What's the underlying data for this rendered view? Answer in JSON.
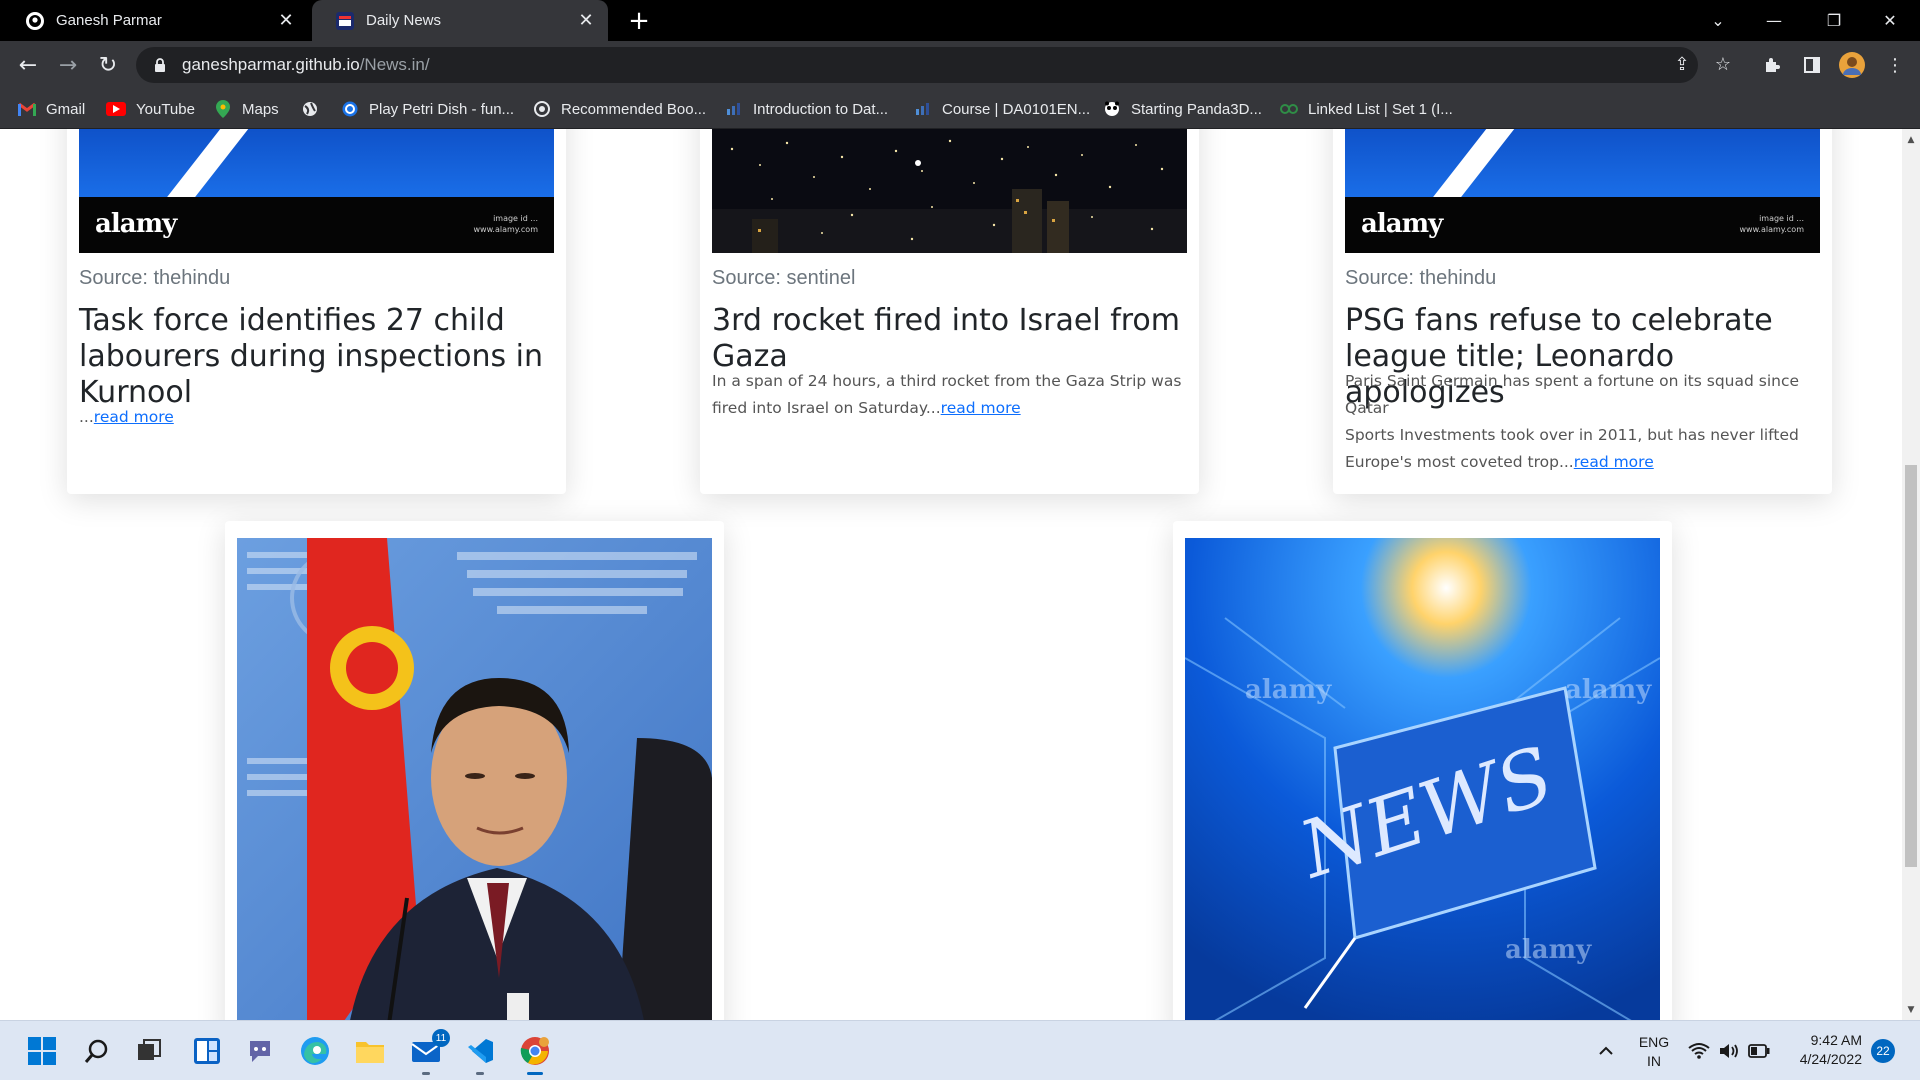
{
  "browser": {
    "tabs": [
      {
        "title": "Ganesh Parmar",
        "active": false
      },
      {
        "title": "Daily News",
        "active": true
      }
    ],
    "url_host": "ganeshparmar.github.io",
    "url_path": "/News.in/",
    "bookmarks": [
      {
        "label": "Gmail",
        "icon": "gmail-icon"
      },
      {
        "label": "YouTube",
        "icon": "youtube-icon"
      },
      {
        "label": "Maps",
        "icon": "maps-icon"
      },
      {
        "label": "",
        "icon": "globe-icon"
      },
      {
        "label": "Play Petri Dish - fun...",
        "icon": "petri-dish-icon"
      },
      {
        "label": "Recommended Boo...",
        "icon": "book-site-icon"
      },
      {
        "label": "Introduction to Dat...",
        "icon": "course-site-icon"
      },
      {
        "label": "Course | DA0101EN...",
        "icon": "course-site-icon"
      },
      {
        "label": "Starting Panda3D...",
        "icon": "panda-icon"
      },
      {
        "label": "Linked List | Set 1 (I...",
        "icon": "gfg-icon"
      }
    ]
  },
  "articles": [
    {
      "source": "Source: thehindu",
      "title_lines": [
        "Task force identifies 27 child",
        "labourers during inspections in",
        "Kurnool"
      ],
      "desc_lines": [
        "..."
      ],
      "read_more": "read more"
    },
    {
      "source": "Source: sentinel",
      "title_lines": [
        "3rd rocket fired into Israel from",
        "Gaza"
      ],
      "desc_lines": [
        "In a span of 24 hours, a third rocket from the Gaza Strip was",
        "fired into Israel on Saturday..."
      ],
      "read_more": "read more"
    },
    {
      "source": "Source: thehindu",
      "title_lines": [
        "PSG fans refuse to celebrate",
        "league title; Leonardo apologizes"
      ],
      "desc_lines": [
        "Paris Saint Germain has spent a fortune on its squad since Qatar",
        "Sports Investments took over in 2011, but has never lifted",
        "Europe's most coveted trop..."
      ],
      "read_more": "read more"
    }
  ],
  "image_text": {
    "alamy": "alamy",
    "alamy_small_1": "image id ...",
    "alamy_small_2": "www.alamy.com",
    "news_word": "NEWS"
  },
  "taskbar": {
    "lang_1": "ENG",
    "lang_2": "IN",
    "time": "9:42 AM",
    "date": "4/24/2022",
    "notifications": "22",
    "mail_badge": "11"
  },
  "colors": {
    "link": "#0d6efd",
    "chrome_bg": "#35363a",
    "tabstrip_bg": "#000000"
  }
}
